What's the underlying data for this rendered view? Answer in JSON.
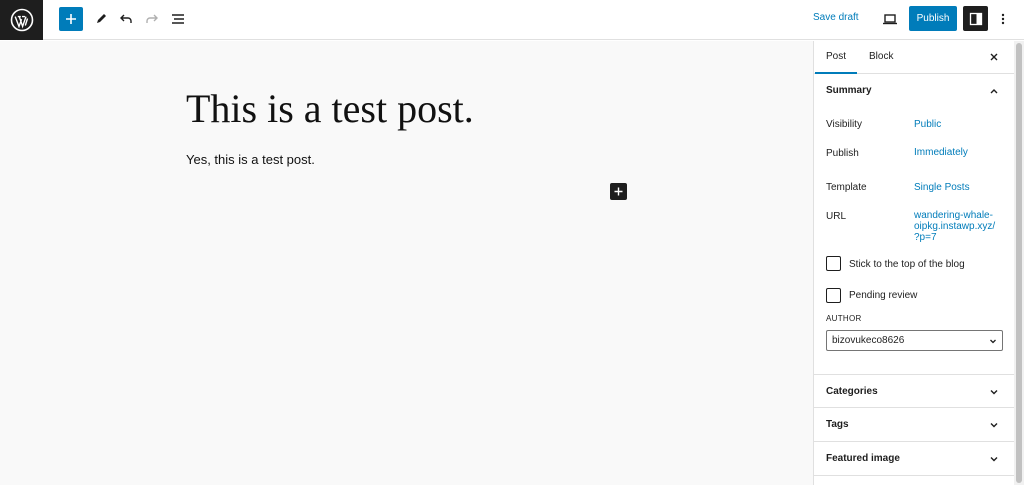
{
  "toolbar": {
    "save_draft_label": "Save draft",
    "publish_label": "Publish"
  },
  "editor": {
    "title": "This is a test post.",
    "paragraph": "Yes, this is a test post."
  },
  "sidebar": {
    "tabs": [
      "Post",
      "Block"
    ],
    "summary": {
      "title": "Summary",
      "rows": [
        {
          "label": "Visibility",
          "value": "Public"
        },
        {
          "label": "Publish",
          "value": "Immediately"
        },
        {
          "label": "Template",
          "value": "Single Posts"
        },
        {
          "label": "URL",
          "value_lines": [
            "wandering-whale-",
            "oipkg.instawp.xyz/",
            "?p=7"
          ]
        }
      ],
      "checkboxes": [
        {
          "label": "Stick to the top of the blog",
          "checked": false
        },
        {
          "label": "Pending review",
          "checked": false
        }
      ],
      "author_label": "AUTHOR",
      "author_value": "bizovukeco8626"
    },
    "panels": [
      "Categories",
      "Tags",
      "Featured image"
    ]
  },
  "colors": {
    "accent": "#007cba",
    "dark": "#1e1e1e",
    "canvas": "#f9f9f9"
  }
}
